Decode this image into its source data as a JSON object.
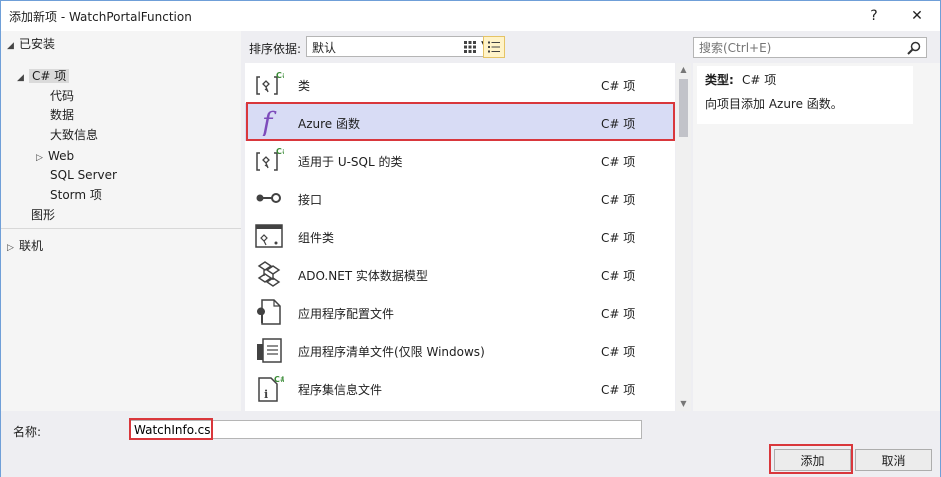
{
  "window": {
    "title": "添加新项 - WatchPortalFunction",
    "help_label": "?",
    "close_label": "✕"
  },
  "tree": {
    "installed": "已安装",
    "csharp": "C# 项",
    "code": "代码",
    "data": "数据",
    "general": "大致信息",
    "web": "Web",
    "sql_server": "SQL Server",
    "storm": "Storm 项",
    "graphics": "图形",
    "online": "联机"
  },
  "toolbar": {
    "sort_label": "排序依据:",
    "sort_value": "默认",
    "grid_view_icon": "grid-view-icon",
    "list_view_icon": "list-view-icon"
  },
  "search": {
    "placeholder": "搜索(Ctrl+E)"
  },
  "templates": [
    {
      "name": "类",
      "category": "C# 项",
      "icon": "class-icon"
    },
    {
      "name": "Azure 函数",
      "category": "C# 项",
      "icon": "azure-function-icon"
    },
    {
      "name": "适用于 U-SQL 的类",
      "category": "C# 项",
      "icon": "class-icon"
    },
    {
      "name": "接口",
      "category": "C# 项",
      "icon": "interface-icon"
    },
    {
      "name": "组件类",
      "category": "C# 项",
      "icon": "component-class-icon"
    },
    {
      "name": "ADO.NET 实体数据模型",
      "category": "C# 项",
      "icon": "entity-model-icon"
    },
    {
      "name": "应用程序配置文件",
      "category": "C# 项",
      "icon": "config-file-icon"
    },
    {
      "name": "应用程序清单文件(仅限 Windows)",
      "category": "C# 项",
      "icon": "manifest-file-icon"
    },
    {
      "name": "程序集信息文件",
      "category": "C# 项",
      "icon": "assembly-info-icon"
    }
  ],
  "details": {
    "type_label": "类型:",
    "type_value": "C# 项",
    "description": "向项目添加 Azure 函数。"
  },
  "footer": {
    "name_label": "名称:",
    "name_value": "WatchInfo.cs",
    "add_label": "添加",
    "cancel_label": "取消"
  },
  "colors": {
    "highlight": "#d9373c",
    "selected_row": "#d8dcf5",
    "function_purple": "#7d4cbb",
    "csharp_green": "#388a34"
  }
}
